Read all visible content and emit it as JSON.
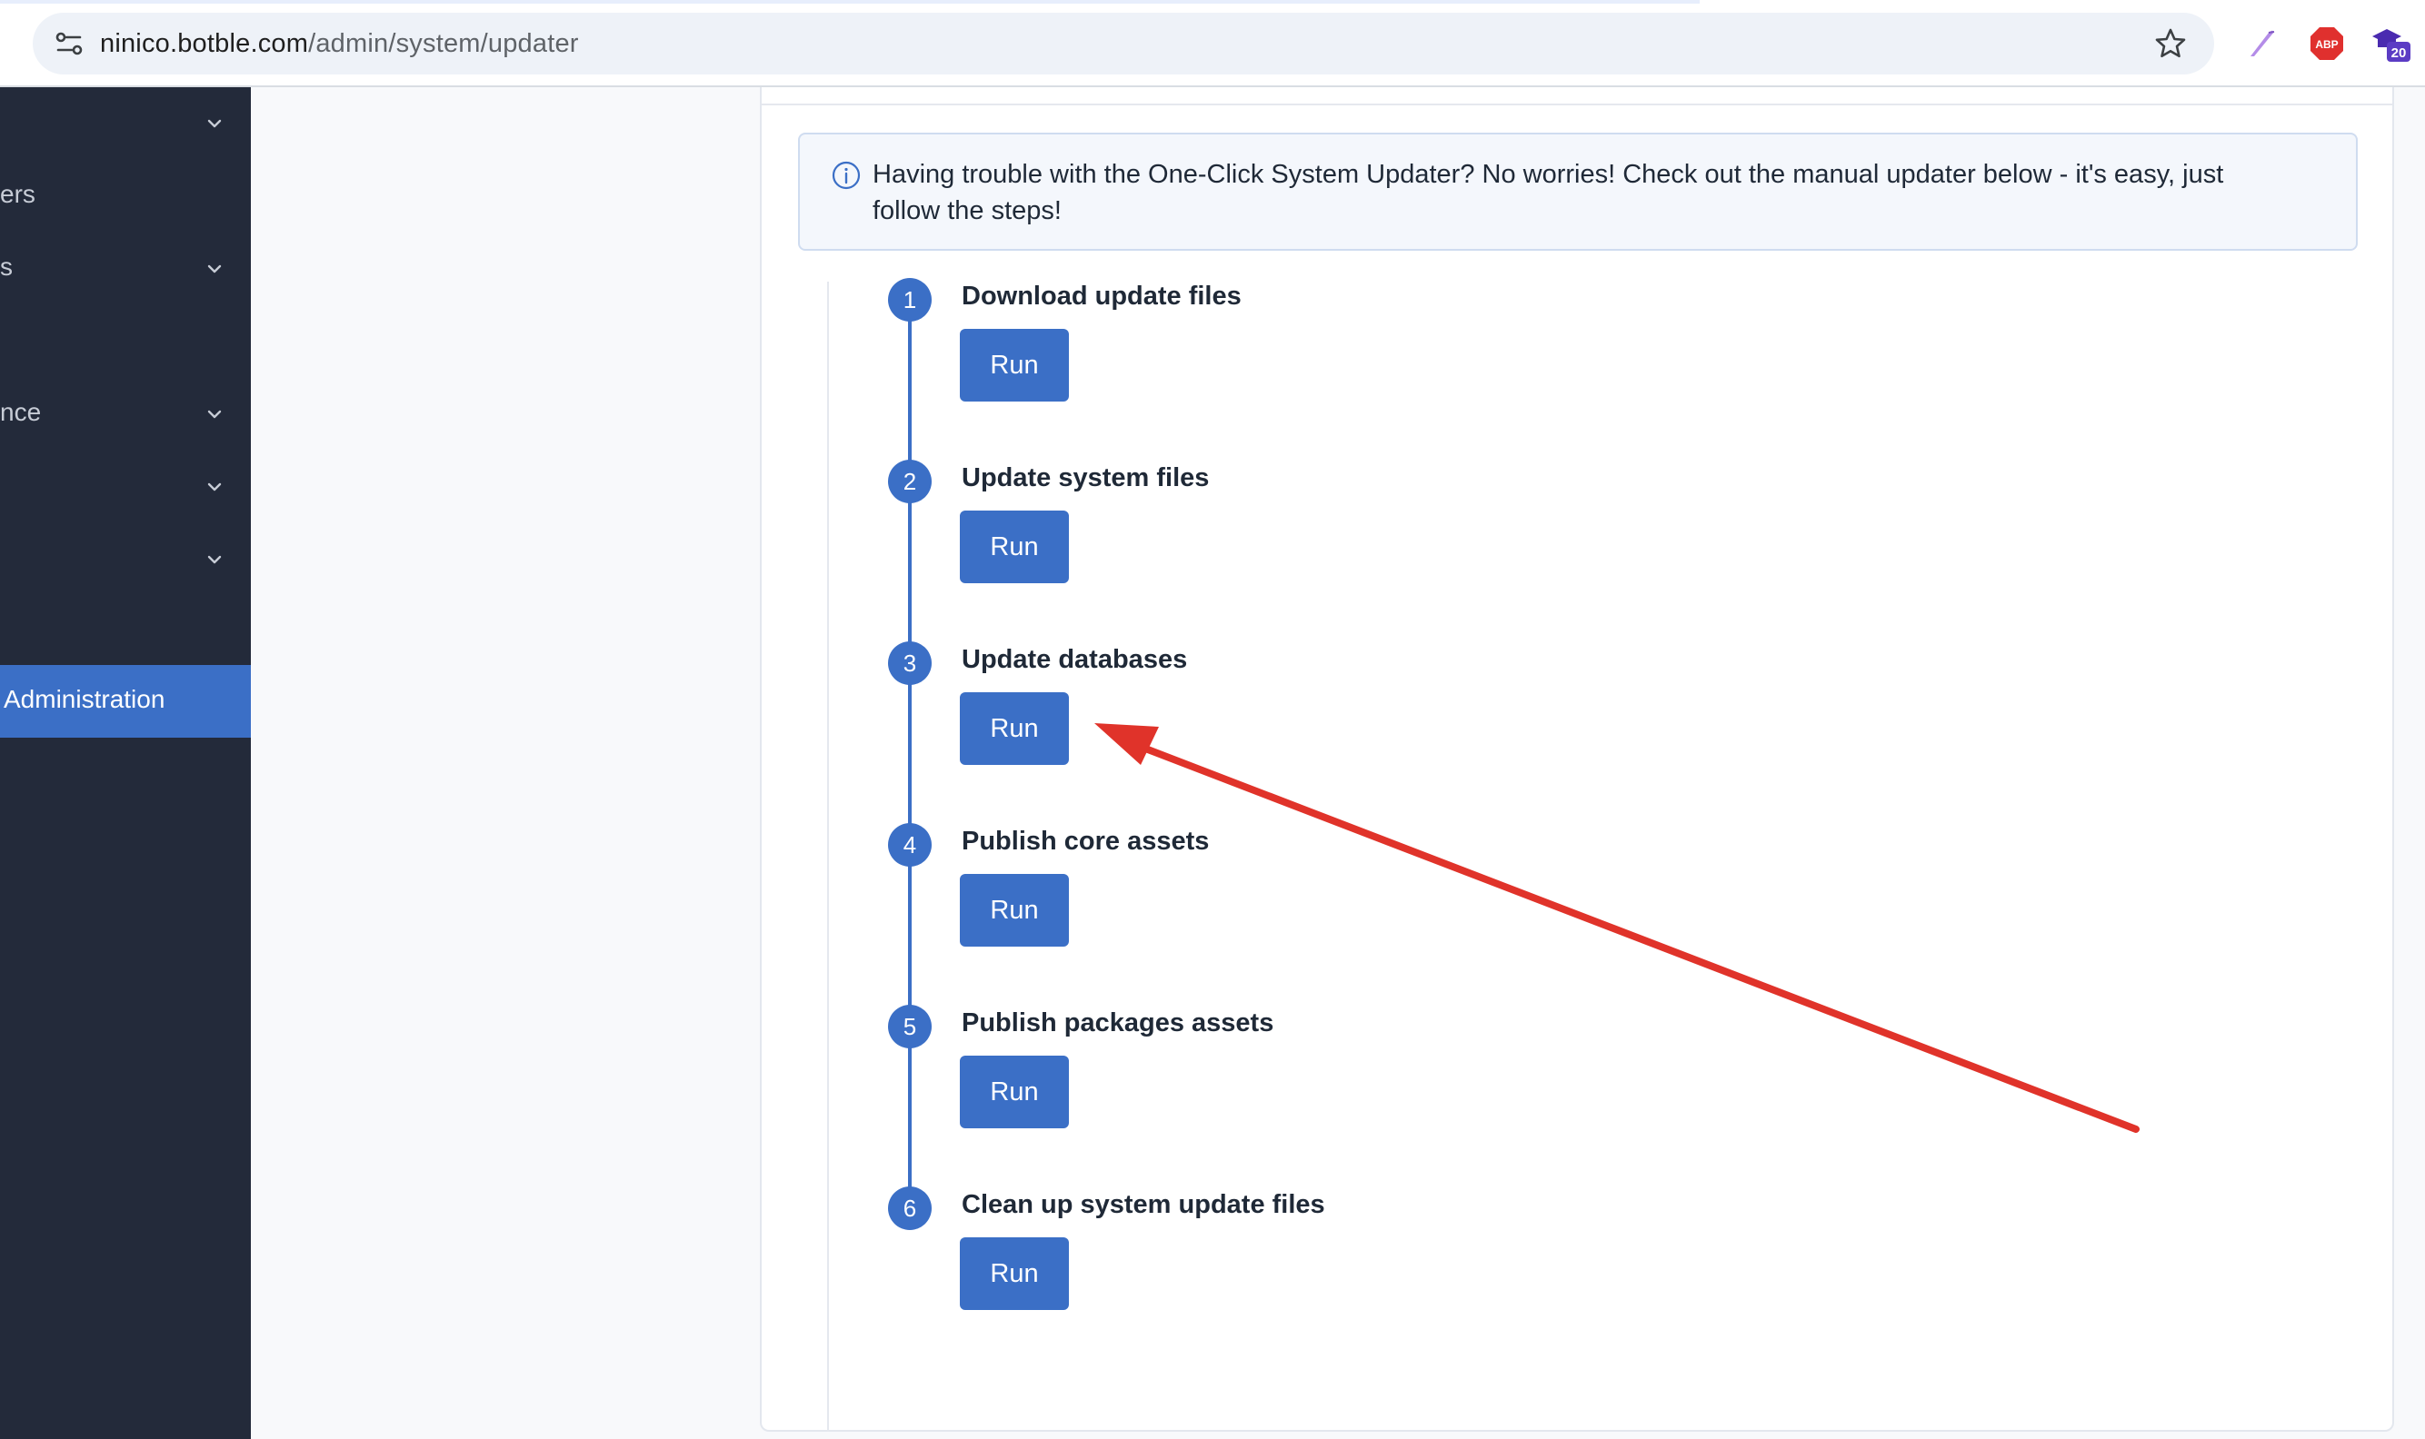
{
  "browser": {
    "url_host": "ninico.botble.com",
    "url_path": "/admin/system/updater",
    "extensions": [
      {
        "name": "pen-extension-icon"
      },
      {
        "name": "adblock-icon",
        "label": "ABP"
      },
      {
        "name": "cap-extension-icon",
        "badge": "20"
      }
    ]
  },
  "sidebar": {
    "items": [
      {
        "label": "",
        "has_chevron": true
      },
      {
        "label": "ers",
        "has_chevron": false
      },
      {
        "label": "s",
        "has_chevron": true
      },
      {
        "label": "nce",
        "has_chevron": true
      },
      {
        "label": "",
        "has_chevron": true
      },
      {
        "label": "",
        "has_chevron": true
      },
      {
        "label": "Administration",
        "active": true
      }
    ]
  },
  "alert": {
    "icon": "info-icon",
    "message": "Having trouble with the One-Click System Updater? No worries! Check out the manual updater below - it's easy, just follow the steps!"
  },
  "steps": [
    {
      "number": "1",
      "title": "Download update files",
      "button": "Run"
    },
    {
      "number": "2",
      "title": "Update system files",
      "button": "Run"
    },
    {
      "number": "3",
      "title": "Update databases",
      "button": "Run"
    },
    {
      "number": "4",
      "title": "Publish core assets",
      "button": "Run"
    },
    {
      "number": "5",
      "title": "Publish packages assets",
      "button": "Run"
    },
    {
      "number": "6",
      "title": "Clean up system update files",
      "button": "Run"
    }
  ],
  "colors": {
    "accent": "#3b6fc6",
    "sidebar_bg": "#232a3a",
    "annotation_arrow": "#e0332a"
  }
}
